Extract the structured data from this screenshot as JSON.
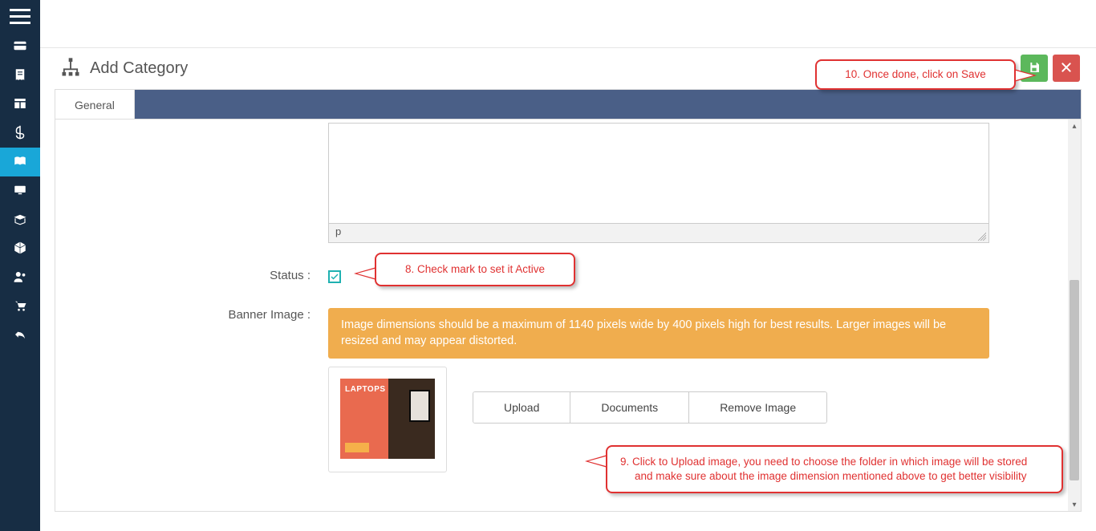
{
  "sidebar": {
    "items": [
      {
        "name": "card-icon"
      },
      {
        "name": "receipt-icon"
      },
      {
        "name": "layout-icon"
      },
      {
        "name": "money-icon"
      },
      {
        "name": "catalog-icon",
        "active": true
      },
      {
        "name": "display-icon"
      },
      {
        "name": "box-open-icon"
      },
      {
        "name": "cube-icon"
      },
      {
        "name": "users-icon"
      },
      {
        "name": "cart-icon"
      },
      {
        "name": "undo-icon"
      }
    ]
  },
  "header": {
    "title": "Add Category",
    "save_tooltip": "Save",
    "close_tooltip": "Close"
  },
  "tabs": [
    {
      "label": "General",
      "active": true
    }
  ],
  "editor": {
    "path": "p"
  },
  "form": {
    "status_label": "Status :",
    "status_checked": true,
    "banner_label": "Banner Image :",
    "banner_alert": "Image dimensions should be a maximum of 1140 pixels wide by 400 pixels high for best results. Larger images will be resized and may appear distorted."
  },
  "buttons": {
    "upload": "Upload",
    "documents": "Documents",
    "remove_image": "Remove Image"
  },
  "thumbnail": {
    "caption": "LAPTOPS"
  },
  "callouts": {
    "c8": "8. Check mark to set it Active",
    "c9": "9.  Click to Upload image, you need to choose the folder in which image will be stored and make sure about the image dimension mentioned above to get better visibility",
    "c10": "10. Once done, click on Save"
  }
}
